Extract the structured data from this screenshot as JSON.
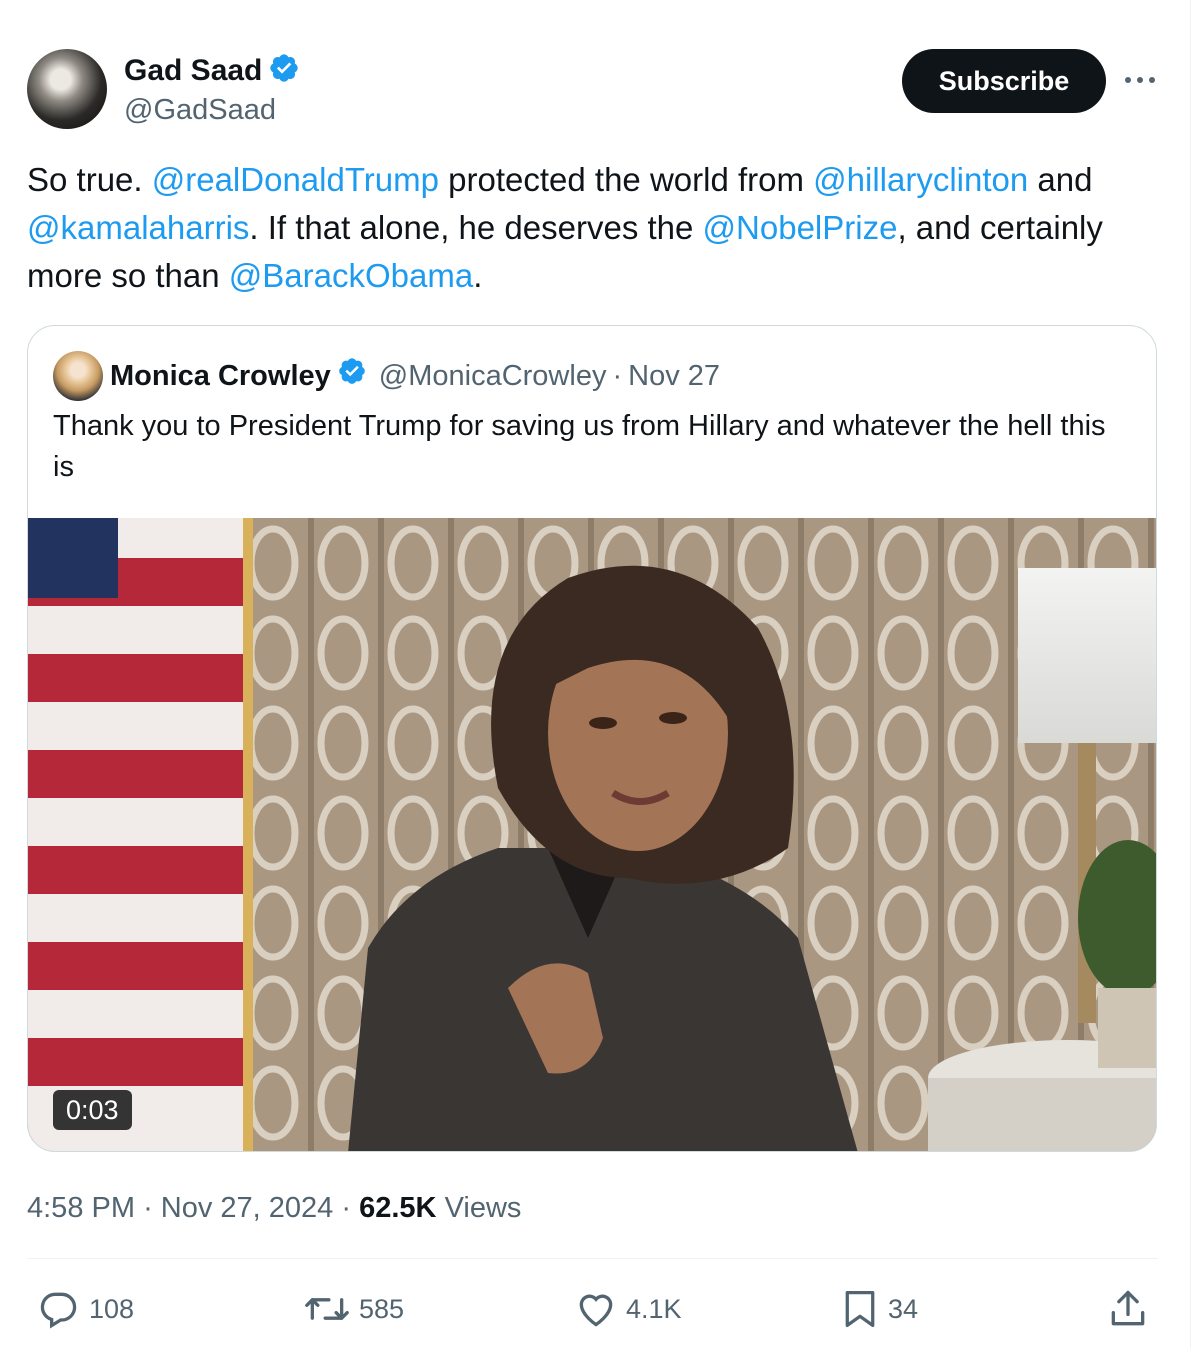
{
  "author": {
    "display_name": "Gad Saad",
    "handle": "@GadSaad",
    "verified_icon": "verified-badge-icon",
    "avatar": "author-avatar-photo"
  },
  "actions_header": {
    "subscribe_label": "Subscribe",
    "more_icon": "more-horizontal-icon"
  },
  "tweet": {
    "text_segments": [
      {
        "t": "So true.  ",
        "mention": false
      },
      {
        "t": "@realDonaldTrump",
        "mention": true
      },
      {
        "t": " protected the world from ",
        "mention": false
      },
      {
        "t": "@hillaryclinton",
        "mention": true
      },
      {
        "t": " and ",
        "mention": false
      },
      {
        "t": "@kamalaharris",
        "mention": true
      },
      {
        "t": ".  If that alone, he deserves the ",
        "mention": false
      },
      {
        "t": "@NobelPrize",
        "mention": true
      },
      {
        "t": ", and certainly more so than ",
        "mention": false
      },
      {
        "t": "@BarackObama",
        "mention": true
      },
      {
        "t": ".",
        "mention": false
      }
    ]
  },
  "quote": {
    "display_name": "Monica Crowley",
    "handle": "@MonicaCrowley",
    "separator": "·",
    "date": "Nov 27",
    "text": "Thank you to President Trump for saving us from Hillary and whatever the hell this is",
    "video": {
      "duration": "0:03",
      "description": "video-thumbnail"
    }
  },
  "meta": {
    "time": "4:58 PM",
    "sep1": "·",
    "date": "Nov 27, 2024",
    "sep2": "·",
    "views_count": "62.5K",
    "views_label": "Views"
  },
  "engagement": {
    "replies": "108",
    "reposts": "585",
    "likes": "4.1K",
    "bookmarks": "34",
    "icons": [
      "reply-icon",
      "repost-icon",
      "like-icon",
      "bookmark-icon",
      "share-icon"
    ]
  },
  "colors": {
    "text": "#0f1419",
    "secondary": "#536471",
    "link": "#1d9bf0",
    "verified": "#1d9bf0",
    "button_bg": "#0f1419",
    "border": "#cfd9de"
  }
}
